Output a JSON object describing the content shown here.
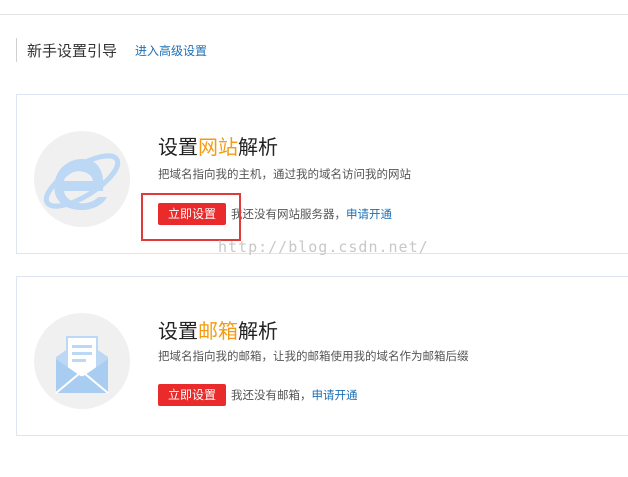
{
  "header": {
    "title": "新手设置引导",
    "advanced_link": "进入高级设置"
  },
  "cards": [
    {
      "icon": "internet-explorer-icon",
      "title_prefix": "设置",
      "title_accent": "网站",
      "title_suffix": "解析",
      "description": "把域名指向我的主机，通过我的域名访问我的网站",
      "button_label": "立即设置",
      "note": "我还没有网站服务器，",
      "apply_link": "申请开通"
    },
    {
      "icon": "mail-envelope-icon",
      "title_prefix": "设置",
      "title_accent": "邮箱",
      "title_suffix": "解析",
      "description": "把域名指向我的邮箱，让我的邮箱使用我的域名作为邮箱后缀",
      "button_label": "立即设置",
      "note": "我还没有邮箱，",
      "apply_link": "申请开通"
    }
  ],
  "watermark": "http://blog.csdn.net/",
  "colors": {
    "accent": "#f39c12",
    "button": "#e92b2b",
    "link": "#1e6fb5",
    "highlight": "#e23a3a"
  }
}
